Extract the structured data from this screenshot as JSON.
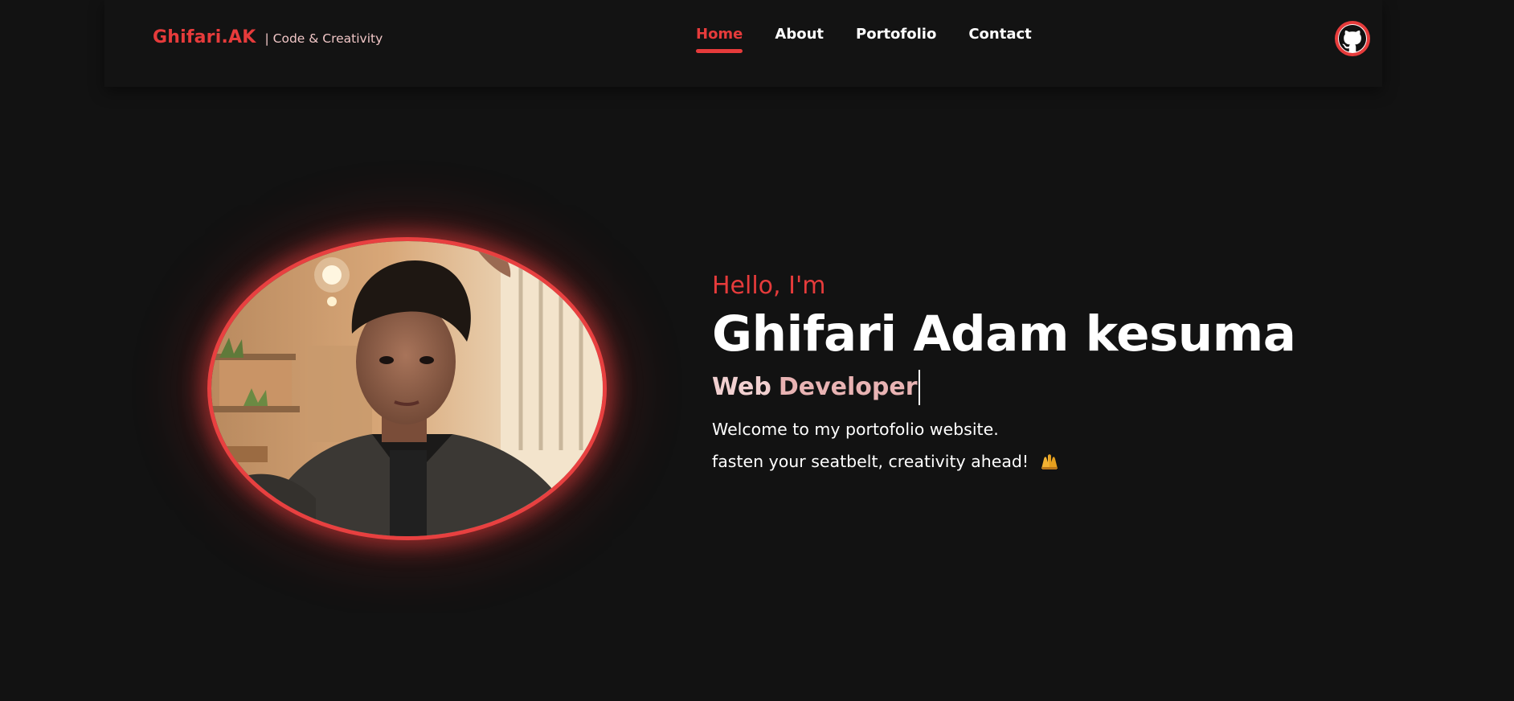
{
  "header": {
    "brand_name": "Ghifari.AK",
    "brand_tagline": "| Code & Creativity",
    "nav": [
      {
        "label": "Home",
        "active": true
      },
      {
        "label": "About",
        "active": false
      },
      {
        "label": "Portofolio",
        "active": false
      },
      {
        "label": "Contact",
        "active": false
      }
    ],
    "github_icon": "github-icon"
  },
  "hero": {
    "greeting": "Hello, I'm",
    "name": "Ghifari Adam kesuma",
    "role_part1": "Web",
    "role_part2": "Developer",
    "line1": "Welcome to my portofolio website.",
    "line2": "fasten your seatbelt, creativity ahead!",
    "emoji_icon": "raising-hands-icon"
  },
  "colors": {
    "background": "#121212",
    "accent": "#e63b3b",
    "text": "#ffffff",
    "role_pink": "#f1d0d0"
  }
}
